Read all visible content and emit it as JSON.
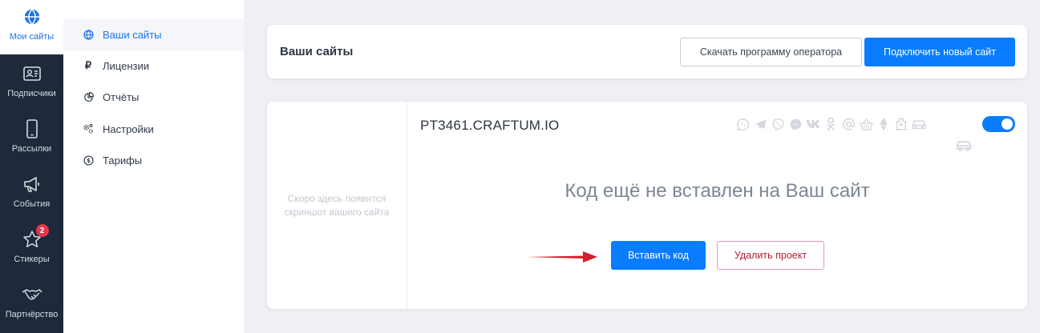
{
  "rail": {
    "items": [
      {
        "label": "Мои сайты",
        "icon": "globe-icon",
        "active": true
      },
      {
        "label": "Подписчики",
        "icon": "contacts-card-icon"
      },
      {
        "label": "Рассылки",
        "icon": "mobile-phone-icon"
      },
      {
        "label": "События",
        "icon": "megaphone-icon"
      },
      {
        "label": "Стикеры",
        "icon": "star-icon",
        "badge": "2"
      },
      {
        "label": "Партнёрство",
        "icon": "handshake-icon"
      }
    ]
  },
  "submenu": {
    "items": [
      {
        "label": "Ваши сайты",
        "icon": "globe-icon",
        "active": true
      },
      {
        "label": "Лицензии",
        "icon": "ruble-icon"
      },
      {
        "label": "Отчёты",
        "icon": "pie-chart-icon"
      },
      {
        "label": "Настройки",
        "icon": "gears-icon"
      },
      {
        "label": "Тарифы",
        "icon": "dollar-circle-icon"
      }
    ]
  },
  "header": {
    "title": "Ваши сайты",
    "download_label": "Скачать программу оператора",
    "connect_label": "Подключить новый сайт"
  },
  "site": {
    "preview_text": "Скоро здесь появится скриншот вашего сайта",
    "domain": "PT3461.CRAFTUM.IO",
    "channels": [
      "whatsapp-icon",
      "telegram-icon",
      "viber-icon",
      "messenger-icon",
      "vk-icon",
      "odnoklassniki-icon",
      "email-icon",
      "basket-icon",
      "ethereum-icon",
      "clinic-icon",
      "car-icon",
      "car-icon"
    ],
    "enabled": true,
    "notice": "Код ещё не вставлен на Ваш сайт",
    "insert_label": "Вставить код",
    "delete_label": "Удалить проект"
  },
  "colors": {
    "accent": "#0a7cff",
    "rail_bg": "#1e2a3b",
    "danger": "#b5203a",
    "badge": "#e5374a",
    "arrow": "#d0202a"
  }
}
